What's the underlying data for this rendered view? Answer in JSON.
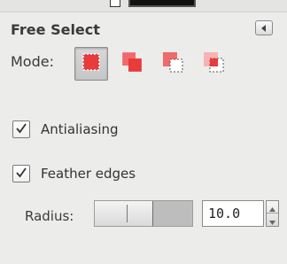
{
  "colors": {
    "panel_bg": "#ececeb",
    "mode_red": "#e83b3b",
    "mode_red_light": "#f06a6a"
  },
  "tool_options": {
    "title": "Free Select",
    "menu_icon": "tab-menu-icon",
    "mode_label": "Mode:",
    "modes": [
      {
        "name": "replace",
        "icon": "replace-selection-icon",
        "active": true
      },
      {
        "name": "add",
        "icon": "add-selection-icon",
        "active": false
      },
      {
        "name": "subtract",
        "icon": "subtract-selection-icon",
        "active": false
      },
      {
        "name": "intersect",
        "icon": "intersect-selection-icon",
        "active": false
      }
    ],
    "antialiasing": {
      "label": "Antialiasing",
      "checked": true
    },
    "feather_edges": {
      "label": "Feather edges",
      "checked": true
    },
    "radius": {
      "label": "Radius:",
      "value": "10.0",
      "slider_fraction": 0.6
    }
  }
}
